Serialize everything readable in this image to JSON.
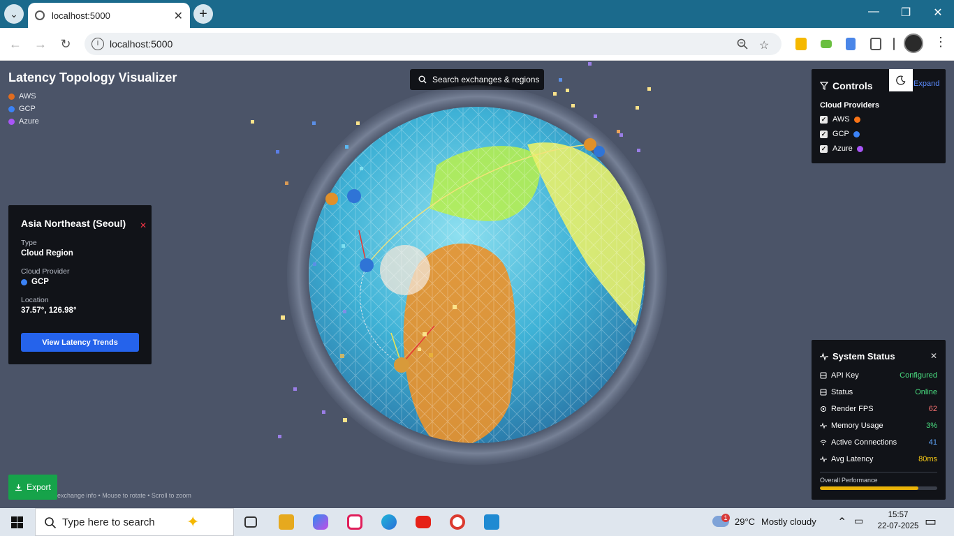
{
  "browser": {
    "tab_title": "localhost:5000",
    "url": "localhost:5000"
  },
  "app": {
    "title": "Latency Topology Visualizer",
    "legend": [
      {
        "label": "AWS",
        "color": "#e06c1f"
      },
      {
        "label": "GCP",
        "color": "#3b82f6"
      },
      {
        "label": "Azure",
        "color": "#a855f7"
      }
    ],
    "search_label": "Search exchanges & regions",
    "hint": "exchange info • Mouse to rotate • Scroll to zoom",
    "export_label": "Export"
  },
  "detail": {
    "title": "Asia Northeast (Seoul)",
    "type_label": "Type",
    "type_value": "Cloud Region",
    "provider_label": "Cloud Provider",
    "provider_value": "GCP",
    "location_label": "Location",
    "location_value": "37.57°, 126.98°",
    "button_label": "View Latency Trends"
  },
  "controls": {
    "title": "Controls",
    "expand_label": "Expand",
    "section_title": "Cloud Providers",
    "providers": [
      {
        "label": "AWS",
        "checked": true,
        "color": "#f97316"
      },
      {
        "label": "GCP",
        "checked": true,
        "color": "#3b82f6"
      },
      {
        "label": "Azure",
        "checked": true,
        "color": "#a855f7"
      }
    ]
  },
  "status": {
    "title": "System Status",
    "rows": [
      {
        "label": "API Key",
        "value": "Configured",
        "color": "#4ade80",
        "icon": "database-icon"
      },
      {
        "label": "Status",
        "value": "Online",
        "color": "#4ade80",
        "icon": "server-icon"
      },
      {
        "label": "Render FPS",
        "value": "62",
        "color": "#f87171",
        "icon": "cpu-icon"
      },
      {
        "label": "Memory Usage",
        "value": "3%",
        "color": "#4ade80",
        "icon": "activity-icon"
      },
      {
        "label": "Active Connections",
        "value": "41",
        "color": "#60a5fa",
        "icon": "wifi-icon"
      },
      {
        "label": "Avg Latency",
        "value": "80ms",
        "color": "#facc15",
        "icon": "pulse-icon"
      }
    ],
    "performance_label": "Overall Performance",
    "performance_fraction": 0.84
  },
  "taskbar": {
    "search_placeholder": "Type here to search",
    "weather_temp": "29°C",
    "weather_desc": "Mostly cloudy",
    "weather_badge": "1",
    "time": "15:57",
    "date": "22-07-2025"
  }
}
